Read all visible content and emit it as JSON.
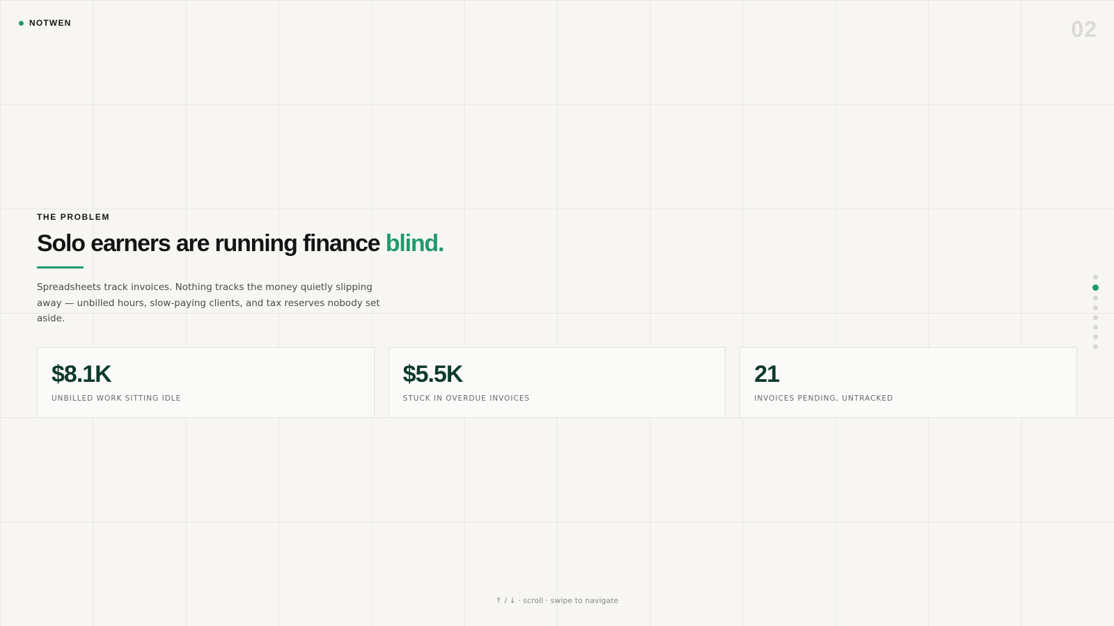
{
  "brand": {
    "name": "NOTWEN",
    "accent_color": "#1f9a6b"
  },
  "page_number": "02",
  "section": {
    "eyebrow": "THE PROBLEM",
    "headline_main": "Solo earners are running finance ",
    "headline_accent": "blind.",
    "body": "Spreadsheets track invoices. Nothing tracks the money quietly slipping away — unbilled hours, slow-paying clients, and tax reserves nobody set aside."
  },
  "stats": [
    {
      "value": "$8.1K",
      "label": "UNBILLED WORK SITTING IDLE"
    },
    {
      "value": "$5.5K",
      "label": "STUCK IN OVERDUE INVOICES"
    },
    {
      "value": "21",
      "label": "INVOICES PENDING, UNTRACKED"
    }
  ],
  "pager": {
    "total": 8,
    "active_index": 1
  },
  "hint": "↑ / ↓ · scroll · swipe to navigate"
}
